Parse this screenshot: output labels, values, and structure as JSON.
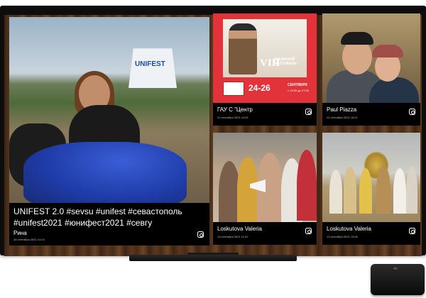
{
  "feed": {
    "main": {
      "text": "UNIFEST 2.0 #sevsu #unifest #севастополь #unifest2021 #юнифест2021 #севгу",
      "author": "Рина",
      "date": "24 сентября 2021 14:14",
      "photo_sign": "UNIFEST"
    },
    "cards": [
      {
        "author": "ГАУ С \"Центр",
        "date": "21 сентября 2021 13:51",
        "poster": {
          "numeral": "VIII",
          "title": "КРЫМСКИЙ ФЕСТИВАЛЬ",
          "dates": "24-26",
          "month": "СЕНТЯБРЯ",
          "time": "с 12:00 до 17:00"
        }
      },
      {
        "author": "Paul Piazza",
        "date": "21 сентября 2021 18:21"
      },
      {
        "author": "Loskutova Valeria",
        "date": "13 сентября 2021 11:01"
      },
      {
        "author": "Loskutova Valeria",
        "date": "13 сентября 2021 19:06"
      }
    ]
  },
  "colors": {
    "poster_red": "#e2333a",
    "wood": "#5a3820",
    "caption_bg": "#000000"
  },
  "icons": {
    "social": "instagram-icon",
    "device": "apple-tv-box"
  }
}
